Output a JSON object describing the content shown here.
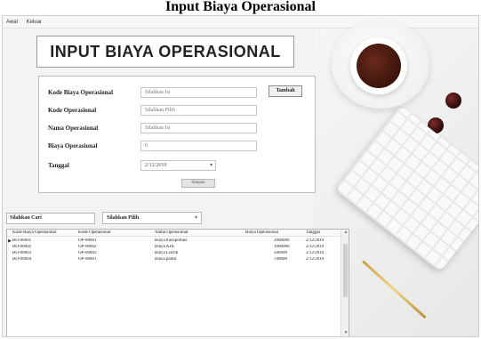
{
  "heading": "Input Biaya Operasional",
  "menu": {
    "items": [
      "Awal",
      "Keluar"
    ]
  },
  "title": "INPUT BIAYA OPERASIONAL",
  "form": {
    "fields": [
      {
        "label": "Kode Biaya Operasional",
        "value": "Silahkan Isi"
      },
      {
        "label": "Kode Operasional",
        "value": "Silahkan Pilih"
      },
      {
        "label": "Nama Operasional",
        "value": "Silahkan Isi"
      },
      {
        "label": "Biaya Operasional",
        "value": "0"
      },
      {
        "label": "Tanggal",
        "value": "2/12/2019"
      }
    ],
    "tambah_label": "Tambah",
    "simpan_label": "Simpan"
  },
  "search": {
    "label": "Silahkan Cari",
    "select_value": "Silahkan Pilih"
  },
  "grid": {
    "columns": [
      "Kode Biaya Operasional",
      "Kode Operasional",
      "Nama Operasional",
      "Biaya Operasional",
      "Tanggal"
    ],
    "rows": [
      [
        "BO-00001",
        "OP-00001",
        "Biaya transportasi",
        "2000000",
        "2/12/2019"
      ],
      [
        "BO-00002",
        "OP-00002",
        "Biaya ATK",
        "1000000",
        "2/12/2019"
      ],
      [
        "BO-00003",
        "OP-00003",
        "Biaya Listrik",
        "500000",
        "2/12/2019"
      ],
      [
        "BO-00004",
        "OP-00001",
        "Biaya parkir",
        "700000",
        "2/12/2019"
      ]
    ],
    "selected_row": 0
  },
  "colors": {
    "window_bg": "#f3f3f3",
    "panel_bg": "#ffffff",
    "border": "#bdbdbd"
  }
}
